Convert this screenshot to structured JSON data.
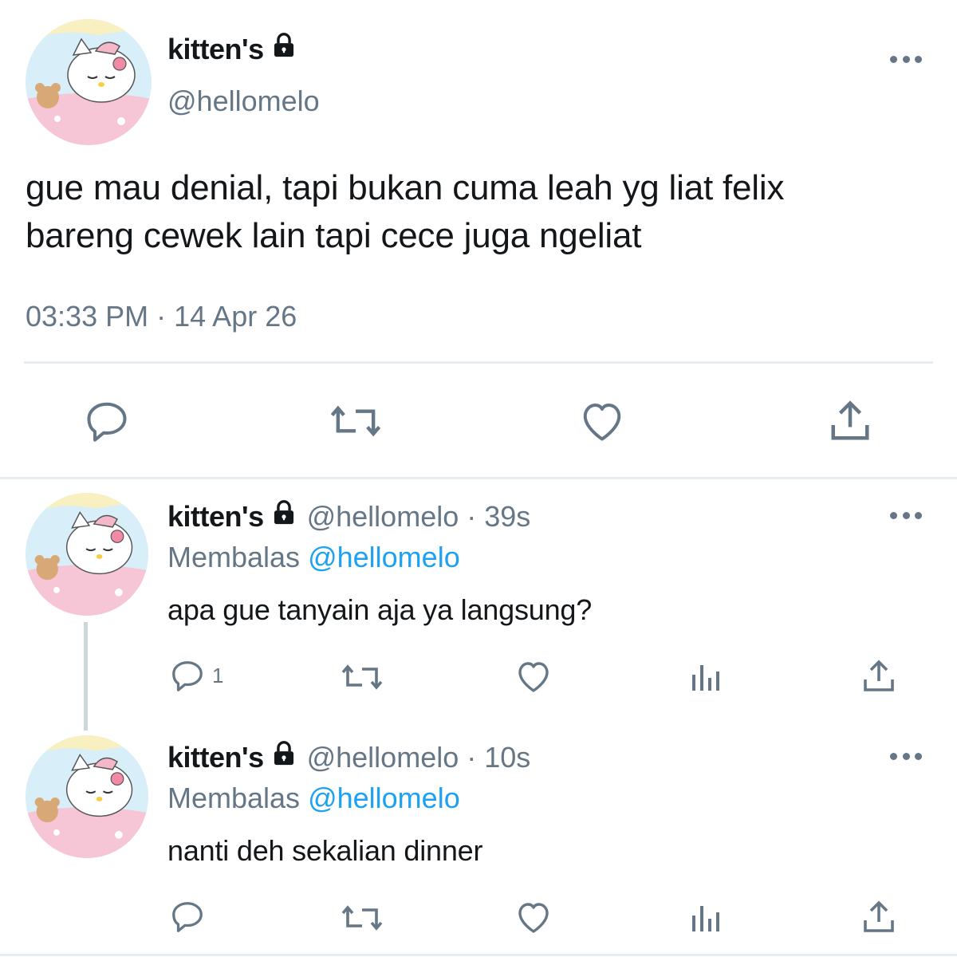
{
  "main_tweet": {
    "author_name": "kitten's",
    "handle": "@hellomelo",
    "text_line1": "gue mau denial, tapi bukan cuma leah yg liat felix",
    "text_line2": "bareng cewek lain tapi cece juga ngeliat",
    "time": "03:33 PM",
    "separator": "·",
    "date": "14 Apr 26",
    "actions": [
      "reply-icon",
      "retweet-icon",
      "like-icon",
      "share-icon"
    ]
  },
  "replies": [
    {
      "author_name": "kitten's",
      "handle_time": "@hellomelo · 39s",
      "replying_prefix": "Membalas",
      "replying_to": "@hellomelo",
      "text": "apa gue tanyain aja ya langsung?",
      "reply_count": "1"
    },
    {
      "author_name": "kitten's",
      "handle_time": "@hellomelo · 10s",
      "replying_prefix": "Membalas",
      "replying_to": "@hellomelo",
      "text": "nanti deh sekalian dinner",
      "reply_count": ""
    }
  ],
  "colors": {
    "text": "#14171a",
    "secondary": "#657786",
    "accent": "#1da1f2",
    "divider": "#e6ecf0",
    "avatar_bg": "#cfe8f5",
    "avatar_blanket": "#f7c6d6"
  }
}
